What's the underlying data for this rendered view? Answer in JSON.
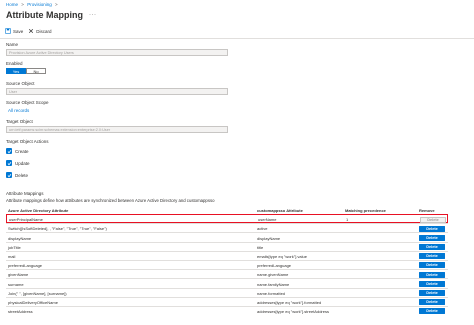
{
  "breadcrumb": {
    "home": "Home",
    "separator": ">",
    "current": "Provisioning",
    "trailing": ">"
  },
  "header": {
    "title": "Attribute Mapping",
    "more": "···"
  },
  "toolbar": {
    "save_label": "Save",
    "discard_label": "Discard"
  },
  "form": {
    "name_label": "Name",
    "name_value": "Provision Azure Active Directory Users",
    "enabled_label": "Enabled",
    "enabled_yes": "Yes",
    "enabled_no": "No",
    "source_object_label": "Source Object",
    "source_object_value": "User",
    "source_scope_label": "Source Object Scope",
    "source_scope_link": "All records",
    "target_object_label": "Target Object",
    "target_object_value": "urn:ietf:params:scim:schemas:extension:enterprise:2.0:User",
    "target_actions_label": "Target Object Actions",
    "actions": [
      "Create",
      "Update",
      "Delete"
    ]
  },
  "mappings": {
    "section_title": "Attribute Mappings",
    "description": "Attribute mappings define how attributes are synchronized between Azure Active Directory and customappsso",
    "headers": [
      "Azure Active Directory Attribute",
      "customappsso Attribute",
      "Matching precedence",
      "Remove"
    ],
    "rows": [
      {
        "source": "userPrincipalName",
        "target": "userName",
        "precedence": "1",
        "action": "Delete"
      },
      {
        "source": "Switch([IsSoftDeleted], , \"False\", \"True\", \"True\", \"False\")",
        "target": "active",
        "precedence": "",
        "action": "Delete"
      },
      {
        "source": "displayName",
        "target": "displayName",
        "precedence": "",
        "action": "Delete"
      },
      {
        "source": "jobTitle",
        "target": "title",
        "precedence": "",
        "action": "Delete"
      },
      {
        "source": "mail",
        "target": "emails[type eq \"work\"].value",
        "precedence": "",
        "action": "Delete"
      },
      {
        "source": "preferredLanguage",
        "target": "preferredLanguage",
        "precedence": "",
        "action": "Delete"
      },
      {
        "source": "givenName",
        "target": "name.givenName",
        "precedence": "",
        "action": "Delete"
      },
      {
        "source": "surname",
        "target": "name.familyName",
        "precedence": "",
        "action": "Delete"
      },
      {
        "source": "Join(\" \", [givenName], [surname])",
        "target": "name.formatted",
        "precedence": "",
        "action": "Delete"
      },
      {
        "source": "physicalDeliveryOfficeName",
        "target": "addresses[type eq \"work\"].formatted",
        "precedence": "",
        "action": "Delete"
      },
      {
        "source": "streetAddress",
        "target": "addresses[type eq \"work\"].streetAddress",
        "precedence": "",
        "action": "Delete"
      }
    ]
  },
  "colors": {
    "accent": "#0078d4",
    "highlight": "#e81123"
  }
}
